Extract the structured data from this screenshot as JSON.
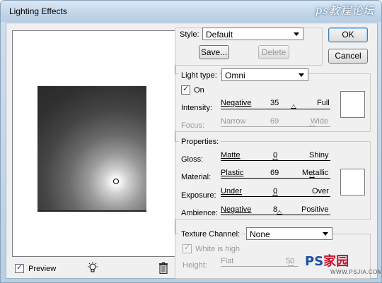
{
  "window": {
    "title": "Lighting Effects"
  },
  "watermark_top": "ps教程论坛",
  "preview": {
    "checkbox_label": "Preview",
    "checked": true
  },
  "icons": {
    "light": "light-bulb-icon",
    "trash": "trash-icon"
  },
  "style": {
    "label": "Style:",
    "value": "Default",
    "save_label": "Save...",
    "delete_label": "Delete"
  },
  "buttons": {
    "ok": "OK",
    "cancel": "Cancel"
  },
  "light": {
    "type_label": "Light type:",
    "type_value": "Omni",
    "on_label": "On",
    "on_checked": true,
    "intensity": {
      "label": "Intensity:",
      "min": "Negative",
      "value": "35",
      "max": "Full"
    },
    "focus": {
      "label": "Focus:",
      "min": "Narrow",
      "value": "69",
      "max": "Wide"
    }
  },
  "properties": {
    "legend": "Properties:",
    "gloss": {
      "label": "Gloss:",
      "min": "Matte",
      "value": "0",
      "max": "Shiny"
    },
    "material": {
      "label": "Material:",
      "min": "Plastic",
      "value": "69",
      "max": "Metallic"
    },
    "exposure": {
      "label": "Exposure:",
      "min": "Under",
      "value": "0",
      "max": "Over"
    },
    "ambience": {
      "label": "Ambience:",
      "min": "Negative",
      "value": "8",
      "max": "Positive"
    }
  },
  "texture": {
    "label": "Texture Channel:",
    "value": "None",
    "white_is_high_label": "White is high",
    "white_is_high_checked": true,
    "height": {
      "label": "Height:",
      "min": "Flat",
      "value": "50"
    }
  },
  "watermark_bottom": {
    "ps": "PS",
    "cn": "家园",
    "url": "WWW.PSJIA.COM"
  }
}
